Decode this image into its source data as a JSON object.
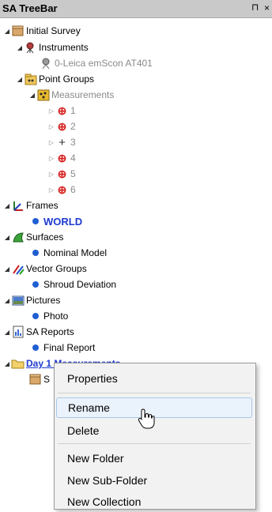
{
  "window": {
    "title": "SA TreeBar",
    "pin_glyph": "⊓",
    "close_glyph": "×"
  },
  "tree": {
    "initial_survey": "Initial Survey",
    "instruments": "Instruments",
    "instrument_0": "0-Leica emScon AT401",
    "point_groups": "Point Groups",
    "measurements": "Measurements",
    "points": [
      "1",
      "2",
      "3",
      "4",
      "5",
      "6"
    ],
    "frames": "Frames",
    "world": "WORLD",
    "surfaces": "Surfaces",
    "nominal_model": "Nominal Model",
    "vector_groups": "Vector Groups",
    "shroud_deviation": "Shroud Deviation",
    "pictures": "Pictures",
    "photo": "Photo",
    "sa_reports": "SA Reports",
    "final_report": "Final Report",
    "day1": "Day 1 Measurements",
    "day1_child": "S"
  },
  "context_menu": {
    "properties": "Properties",
    "rename": "Rename",
    "delete": "Delete",
    "new_folder": "New Folder",
    "new_subfolder": "New Sub-Folder",
    "new_collection": "New Collection"
  },
  "colors": {
    "accent": "#1d3ad0",
    "target_red": "#d81f1f",
    "titlebar": "#c9c9c9"
  }
}
